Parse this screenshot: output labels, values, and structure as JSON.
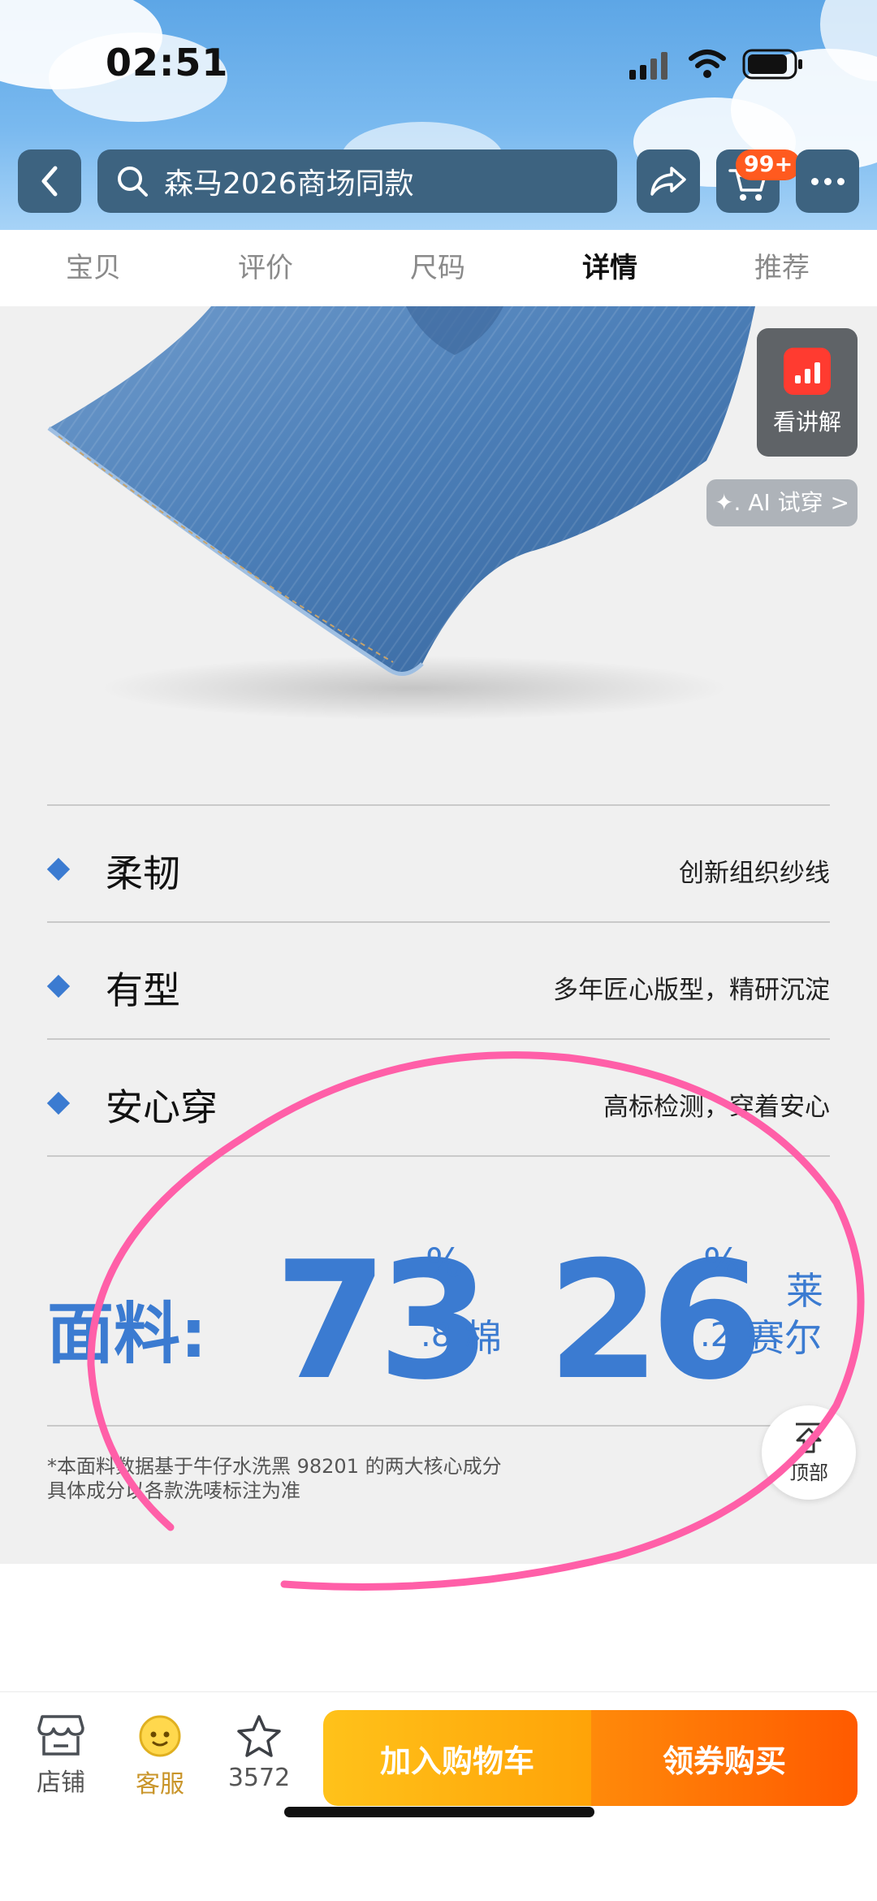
{
  "status_bar": {
    "time": "02:51"
  },
  "header": {
    "search_text": "森马2026商场同款",
    "cart_badge": "99+"
  },
  "tabs": [
    {
      "label": "宝贝"
    },
    {
      "label": "评价"
    },
    {
      "label": "尺码"
    },
    {
      "label": "详情",
      "active": true
    },
    {
      "label": "推荐"
    }
  ],
  "floating": {
    "ai_explain_label": "看讲解",
    "ai_tryon_label": "✦. AI 试穿 >",
    "back_to_top_label": "顶部"
  },
  "features": [
    {
      "title": "柔韧",
      "desc": "创新组织纱线"
    },
    {
      "title": "有型",
      "desc": "多年匠心版型，精研沉淀"
    },
    {
      "title": "安心穿",
      "desc": "高标检测，穿着安心"
    }
  ],
  "fabric": {
    "label": "面料:",
    "cotton_int": "73",
    "cotton_dec": ".8",
    "cotton_pct": "%",
    "cotton_name": "棉",
    "lyocell_int": "26",
    "lyocell_dec": ".2",
    "lyocell_pct": "%",
    "lyocell_name_1": "莱",
    "lyocell_name_2": "赛尔",
    "footnote_1": "*本面料数据基于牛仔水洗黑 98201 的两大核心成分",
    "footnote_2": "具体成分以各款洗唛标注为准"
  },
  "bottom_bar": {
    "shop_label": "店铺",
    "service_label": "客服",
    "favorites_count": "3572",
    "add_cart_label": "加入购物车",
    "buy_label": "领券购买"
  },
  "colors": {
    "accent_blue": "#3b7bd1",
    "annotation_pink": "#ff5fa8",
    "cart_badge": "#ff5a1f",
    "buy_orange": "#ff5a00",
    "add_cart_yellow": "#ffc21a"
  }
}
